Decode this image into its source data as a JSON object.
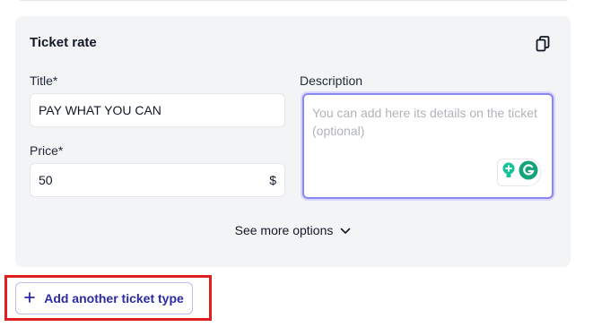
{
  "ticket_rate": {
    "title": "Ticket rate",
    "title_field": {
      "label": "Title*",
      "value": "PAY WHAT YOU CAN"
    },
    "price_field": {
      "label": "Price*",
      "value": "50",
      "currency": "$"
    },
    "description_field": {
      "label": "Description",
      "placeholder": "You can add here its details on the ticket (optional)"
    },
    "see_more_label": "See more options"
  },
  "add_ticket_type_button": {
    "label": "Add another ticket type"
  },
  "icons": {
    "copy": "copy-icon",
    "chevron": "chevron-down-icon",
    "plus": "plus-icon",
    "lightbulb": "lightbulb-icon",
    "grammarly": "grammarly-icon"
  },
  "colors": {
    "accent": "#2d2aa5",
    "focus_border": "#8b87f0",
    "card_background": "#f3f4f6",
    "highlight": "#e11d1d",
    "grammarly_green": "#15c39a"
  }
}
